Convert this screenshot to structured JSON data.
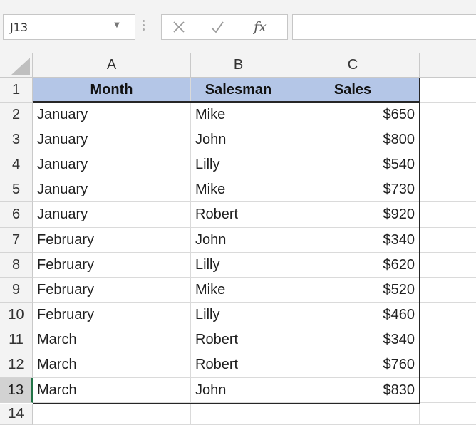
{
  "name_box": {
    "value": "J13"
  },
  "formula_bar": {
    "cancel_glyph": "✕",
    "enter_glyph": "✓",
    "fx_label": "fx",
    "value": ""
  },
  "columns": [
    "A",
    "B",
    "C"
  ],
  "rows": [
    "1",
    "2",
    "3",
    "4",
    "5",
    "6",
    "7",
    "8",
    "9",
    "10",
    "11",
    "12",
    "13",
    "14"
  ],
  "table": {
    "headers": [
      "Month",
      "Salesman",
      "Sales"
    ],
    "data": [
      [
        "January",
        "Mike",
        "$650"
      ],
      [
        "January",
        "John",
        "$800"
      ],
      [
        "January",
        "Lilly",
        "$540"
      ],
      [
        "January",
        "Mike",
        "$730"
      ],
      [
        "January",
        "Robert",
        "$920"
      ],
      [
        "February",
        "John",
        "$340"
      ],
      [
        "February",
        "Lilly",
        "$620"
      ],
      [
        "February",
        "Mike",
        "$520"
      ],
      [
        "February",
        "Lilly",
        "$460"
      ],
      [
        "March",
        "Robert",
        "$340"
      ],
      [
        "March",
        "Robert",
        "$760"
      ],
      [
        "March",
        "John",
        "$830"
      ]
    ]
  },
  "colors": {
    "header_fill": "#b4c6e7",
    "table_border": "#262626",
    "active_row_accent": "#217346"
  }
}
